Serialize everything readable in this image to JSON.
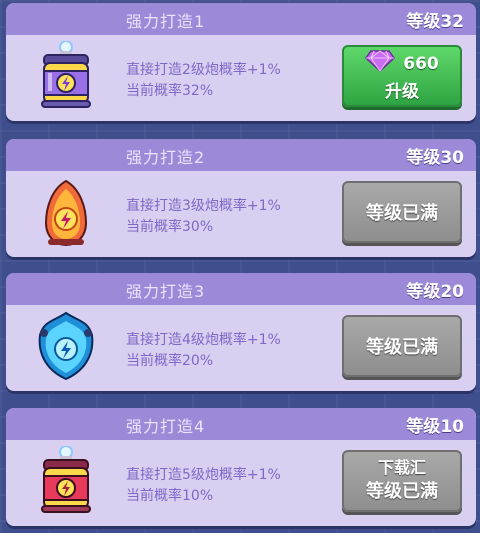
{
  "colors": {
    "background": "#3f4f8e",
    "card": "#d9d0f1",
    "header": "#9c8ad8",
    "text_purple": "#7e68c8",
    "button_green": "#3fbf52",
    "button_gray": "#9a9a9a",
    "gem": "#c86cf0"
  },
  "cards": [
    {
      "title": "强力打造1",
      "level": "等级32",
      "description": "直接打造2级炮概率+1%",
      "probability": "当前概率32%",
      "icon": "lightning-battery-icon",
      "button": {
        "type": "upgrade",
        "cost": "660",
        "cost_icon": "gem-icon",
        "label": "升级"
      }
    },
    {
      "title": "强力打造2",
      "level": "等级30",
      "description": "直接打造3级炮概率+1%",
      "probability": "当前概率30%",
      "icon": "lightning-egg-icon",
      "button": {
        "type": "maxed",
        "label": "等级已满"
      }
    },
    {
      "title": "强力打造3",
      "level": "等级20",
      "description": "直接打造4级炮概率+1%",
      "probability": "当前概率20%",
      "icon": "lightning-shield-icon",
      "button": {
        "type": "maxed",
        "label": "等级已满"
      }
    },
    {
      "title": "强力打造4",
      "level": "等级10",
      "description": "直接打造5级炮概率+1%",
      "probability": "当前概率10%",
      "icon": "lightning-battery-red-icon",
      "button": {
        "type": "maxed",
        "label": "等级已满",
        "overlay_text": "下载汇"
      }
    }
  ]
}
